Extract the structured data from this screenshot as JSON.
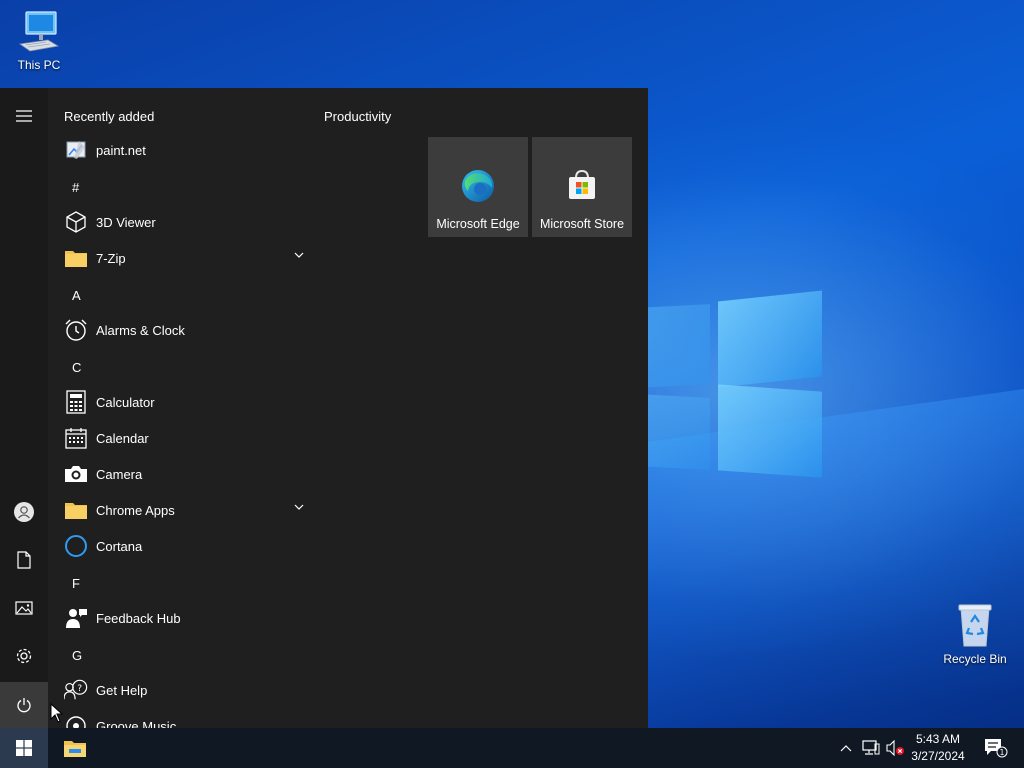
{
  "desktop": {
    "icons": [
      {
        "label": "This PC",
        "icon": "computer-icon"
      },
      {
        "label": "Recycle Bin",
        "icon": "recycle-bin-icon"
      }
    ]
  },
  "start_menu": {
    "rail": {
      "menu_icon": "hamburger-icon",
      "bottom": [
        "user-icon",
        "documents-icon",
        "pictures-icon",
        "settings-icon",
        "power-icon"
      ]
    },
    "recently_added_title": "Recently added",
    "recently_added": [
      {
        "label": "paint.net",
        "icon": "paint-net-icon"
      }
    ],
    "apps": [
      {
        "letter": "#"
      },
      {
        "label": "3D Viewer",
        "icon": "cube-icon"
      },
      {
        "label": "7-Zip",
        "icon": "folder-icon",
        "expandable": true
      },
      {
        "letter": "A"
      },
      {
        "label": "Alarms & Clock",
        "icon": "alarm-clock-icon"
      },
      {
        "letter": "C"
      },
      {
        "label": "Calculator",
        "icon": "calculator-icon"
      },
      {
        "label": "Calendar",
        "icon": "calendar-icon"
      },
      {
        "label": "Camera",
        "icon": "camera-icon"
      },
      {
        "label": "Chrome Apps",
        "icon": "folder-icon",
        "expandable": true
      },
      {
        "label": "Cortana",
        "icon": "cortana-icon"
      },
      {
        "letter": "F"
      },
      {
        "label": "Feedback Hub",
        "icon": "feedback-hub-icon"
      },
      {
        "letter": "G"
      },
      {
        "label": "Get Help",
        "icon": "get-help-icon"
      },
      {
        "label": "Groove Music",
        "icon": "groove-music-icon"
      }
    ],
    "group_title": "Productivity",
    "tiles": [
      {
        "label": "Microsoft Edge",
        "icon": "edge-icon"
      },
      {
        "label": "Microsoft Store",
        "icon": "store-icon"
      }
    ]
  },
  "taskbar": {
    "pinned": [
      "file-explorer-icon"
    ],
    "tray_icons": [
      "chevron-up-icon",
      "network-icon",
      "volume-muted-icon"
    ],
    "time": "5:43 AM",
    "date": "3/27/2024",
    "notification_count": "1"
  },
  "colors": {
    "start_bg": "#1f1f1f",
    "tile_bg": "#3c3c3c",
    "taskbar_bg": "#101823",
    "folder": "#f2c14e",
    "cortana": "#2d9cf5"
  }
}
